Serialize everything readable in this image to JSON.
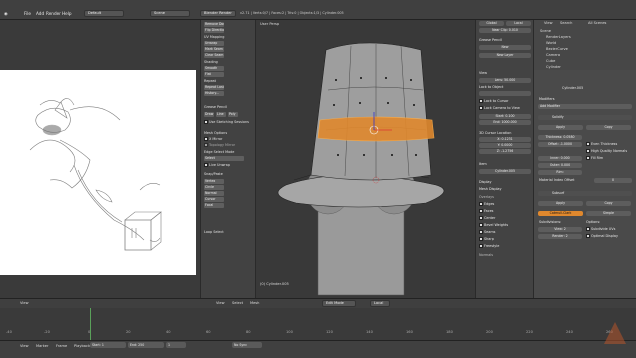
{
  "menu": {
    "file": "File",
    "add": "Add",
    "render": "Render",
    "help": "Help",
    "layout": "Default",
    "scene": "Scene",
    "engine": "Blender Render",
    "info": "v2.71 | Verts:0/7 | Faces:2 | Tris:0 | Objects:1/3 | Cylinder.005"
  },
  "toolshelf": {
    "buttons": [
      "Remove Doubles",
      "Flip Direction",
      "UV Mapping",
      "Unwrap",
      "Mark Seam",
      "Clear Seam",
      "Shading",
      "Smooth",
      "Flat",
      "Repeat",
      "Repeat Last",
      "History..."
    ],
    "grease": "Grease Pencil",
    "grease_buttons": [
      "Draw",
      "Line",
      "Poly"
    ],
    "use_sketch": "Use Sketching Sessions",
    "mesh_options": "Mesh Options",
    "xmirror": "X Mirror",
    "topology": "Topology Mirror",
    "edge_select": "Edge Select Mode",
    "select": "Select",
    "live_unwrap": "Live Unwrap",
    "snap": "Snap/Paste",
    "snap_items": [
      "Vertex",
      "Circle",
      "Normal",
      "Cursor",
      "Focal"
    ],
    "loop_select": "Loop Select"
  },
  "viewport": {
    "title": "User Persp",
    "object": "(0) Cylinder.005",
    "mode": "Edit Mode",
    "pivot": "Local",
    "menus": [
      "View",
      "Select",
      "Mesh"
    ]
  },
  "props": {
    "tab_global": "Global",
    "tab_local": "Local",
    "clip": "Near Clip: 0.010",
    "grease": "Grease Pencil",
    "new": "New",
    "new_layer": "New Layer",
    "view": "View",
    "lens": "Lens: 50.000",
    "lock": "Lock to Object",
    "lock_cursor": "Lock to Cursor",
    "lock_camera": "Lock Camera to View",
    "start": "Start: 0.100",
    "end": "End: 1000.000",
    "cursor": "3D Cursor Location",
    "cx": "X: 0.1231",
    "cy": "Y: 0.0000",
    "cz": "Z: -1.2756",
    "item": "Item",
    "item_name": "Cylinder.005",
    "display": "Display",
    "mesh_display": "Mesh Display",
    "overlays": "Overlays",
    "checks": [
      "Edges",
      "Faces",
      "Center",
      "Bevel Weights",
      "Seams",
      "Sharp",
      "Freestyle"
    ],
    "normals": "Normals"
  },
  "outliner": {
    "tabs": [
      "View",
      "Search",
      "All Scenes"
    ],
    "items": [
      "Scene",
      "RenderLayers",
      "World",
      "BezierCurve",
      "Camera",
      "Cube",
      "Cylinder",
      "Cylinder.005"
    ]
  },
  "modifiers": {
    "obj": "Cylinder.005",
    "title": "Modifiers",
    "add": "Add Modifier",
    "m1": "Solidify",
    "apply": "Apply",
    "copy": "Copy",
    "thickness": "Thickness: 0.0580",
    "offset": "Offset: -1.0000",
    "inner": "Inner: 0.000",
    "outer": "Outer: 0.000",
    "rim": "Rim:",
    "even": "Even Thickness",
    "hq": "High Quality Normals",
    "fill": "Fill Rim",
    "mat": "Material Index Offset",
    "mat_val": "0",
    "m2": "Subsurf",
    "catmull": "Catmull-Clark",
    "simple": "Simple",
    "subdiv": "Subdivisions:",
    "view": "View: 2",
    "render": "Render: 2",
    "options": "Options:",
    "subdiv_uvs": "Subdivide UVs",
    "optimal": "Optimal Display"
  },
  "timeline": {
    "menus": [
      "View",
      "Marker",
      "Frame",
      "Playback"
    ],
    "start": "Start: 1",
    "end": "End: 250",
    "frame": "1",
    "sync": "No Sync",
    "ticks": [
      "-40",
      "-20",
      "0",
      "20",
      "40",
      "60",
      "80",
      "100",
      "120",
      "140",
      "160",
      "180",
      "200",
      "220",
      "240",
      "260"
    ]
  }
}
